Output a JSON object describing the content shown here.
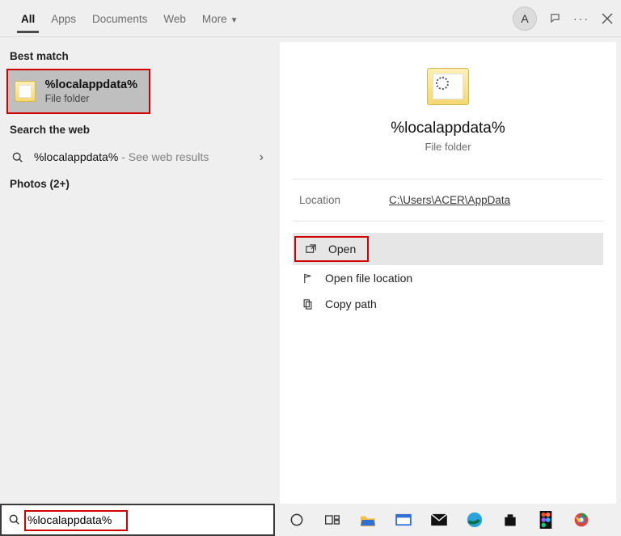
{
  "header": {
    "tabs": [
      "All",
      "Apps",
      "Documents",
      "Web",
      "More"
    ],
    "active_tab": 0,
    "avatar_letter": "A"
  },
  "left_panel": {
    "best_match_label": "Best match",
    "best_match": {
      "title": "%localappdata%",
      "subtitle": "File folder"
    },
    "search_web_label": "Search the web",
    "web_result": {
      "term": "%localappdata%",
      "hint": " - See web results"
    },
    "photos_label": "Photos (2+)"
  },
  "preview": {
    "title": "%localappdata%",
    "subtitle": "File folder",
    "location_label": "Location",
    "location_value": "C:\\Users\\ACER\\AppData",
    "actions": {
      "open": "Open",
      "open_file_location": "Open file location",
      "copy_path": "Copy path"
    }
  },
  "search": {
    "value": "%localappdata%"
  },
  "taskbar": {
    "icons": [
      "cortana",
      "task-view",
      "file-explorer",
      "mail-inbox",
      "mail",
      "edge",
      "store",
      "figma",
      "chrome"
    ]
  }
}
